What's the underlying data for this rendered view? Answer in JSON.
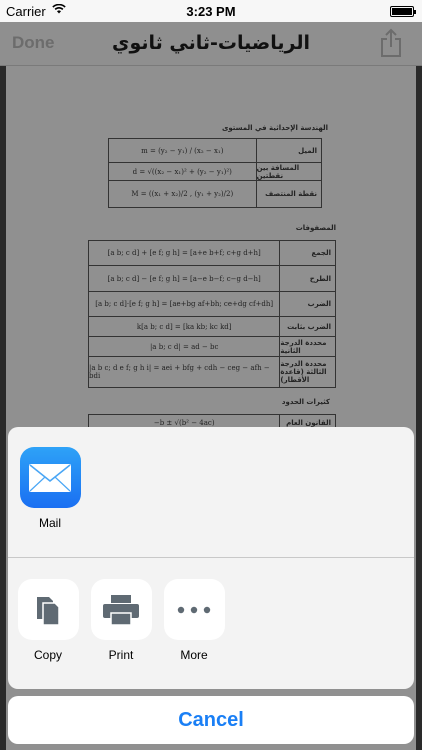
{
  "status_bar": {
    "carrier": "Carrier",
    "wifi_icon": "wifi-icon",
    "time": "3:23 PM",
    "battery_icon": "battery-icon"
  },
  "nav": {
    "done_label": "Done",
    "title": "الرياضيات-ثاني ثانوي",
    "share_icon": "share-icon"
  },
  "document": {
    "section1_title": "الهندسة الإحداثية في المستوى",
    "table1": [
      {
        "label": "الميل",
        "formula": "m = (y₂ − y₁) / (x₂ − x₁)"
      },
      {
        "label": "المسافة بين نقطتين",
        "formula": "d = √((x₂ − x₁)² + (y₂ − y₁)²)"
      },
      {
        "label": "نقطة المنتصف",
        "formula": "M = ((x₁ + x₂)/2 , (y₁ + y₂)/2)"
      }
    ],
    "section2_title": "المصفوفات",
    "table2": [
      {
        "label": "الجمع",
        "formula": "[a b; c d] + [e f; g h] = [a+e b+f; c+g d+h]"
      },
      {
        "label": "الطرح",
        "formula": "[a b; c d] − [e f; g h] = [a−e b−f; c−g d−h]"
      },
      {
        "label": "الضرب",
        "formula": "[a b; c d]·[e f; g h] = [ae+bg af+bh; ce+dg cf+dh]"
      },
      {
        "label": "الضرب بثابت",
        "formula": "k[a b; c d] = [ka kb; kc kd]"
      },
      {
        "label": "محددة الدرجة الثانية",
        "formula": "|a b; c d| = ad − bc"
      },
      {
        "label": "محددة الدرجة الثالثة (قاعدة الأقطار)",
        "formula": "|a b c; d e f; g h i| = aei + bfg + cdh − ceg − afh − bdi"
      }
    ],
    "section3_title": "كثيرات الحدود",
    "table3": [
      {
        "label": "القانون العام",
        "formula": "−b ± √(b² − 4ac)"
      }
    ]
  },
  "share_sheet": {
    "apps": [
      {
        "label": "Mail",
        "icon": "mail-icon"
      }
    ],
    "actions": [
      {
        "label": "Copy",
        "icon": "copy-icon"
      },
      {
        "label": "Print",
        "icon": "print-icon"
      },
      {
        "label": "More",
        "icon": "more-icon"
      }
    ],
    "cancel_label": "Cancel"
  },
  "colors": {
    "accent": "#1a7ff5",
    "mail_top": "#2ea2f7",
    "mail_bottom": "#1a6ff2"
  }
}
